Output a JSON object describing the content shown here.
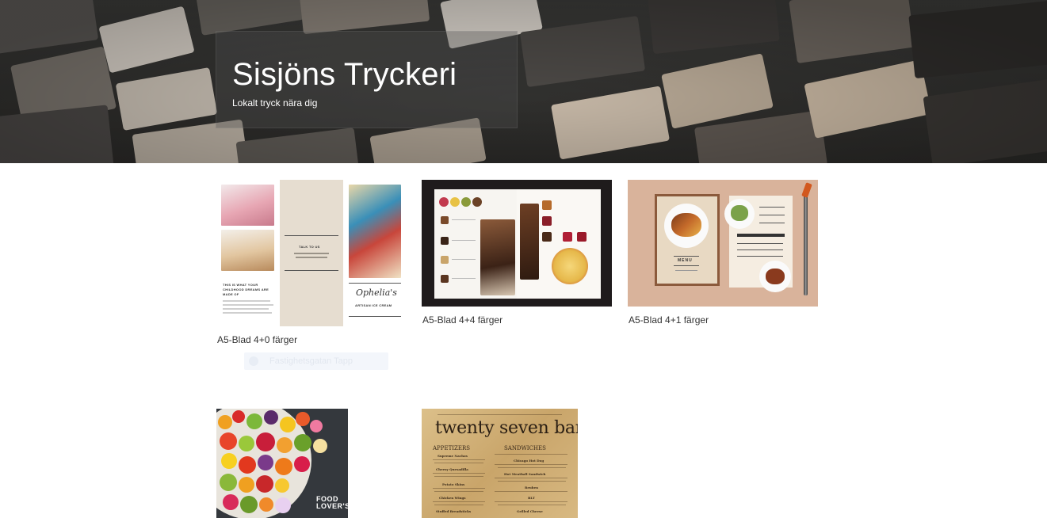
{
  "header": {
    "title": "Sisjöns Tryckeri",
    "tagline": "Lokalt tryck nära dig"
  },
  "products": [
    {
      "caption": "A5-Blad 4+0 färger",
      "image_text": {
        "talk": "TALK TO US",
        "headline": "THIS IS WHAT YOUR CHILDHOOD DREAMS ARE MADE OF",
        "brand": "Ophelia's",
        "brand_sub": "ARTISAN ICE CREAM"
      }
    },
    {
      "caption": "A5-Blad 4+4 färger"
    },
    {
      "caption": "A5-Blad 4+1 färger",
      "image_text": {
        "menu": "MENU"
      }
    },
    {
      "caption": "",
      "image_text": {
        "brand": "FOOD LOVER'S"
      }
    },
    {
      "caption": "",
      "image_text": {
        "title": "twenty seven bar",
        "section_left": "APPETIZERS",
        "section_right": "SANDWICHES",
        "left_items": [
          "Supreme Nachos",
          "Cheesy Quesadilla",
          "Potato Skins",
          "Chicken Wings",
          "Stuffed Breadsticks"
        ],
        "right_items": [
          "Chicago Hot Dog",
          "Hot Meatball Sandwich",
          "Reuben",
          "BLT",
          "Grilled Cheese"
        ]
      }
    }
  ],
  "faint_link": {
    "label": "Fastighetsgatan Tapp",
    "icon": "circle-icon"
  },
  "colors": {
    "background": "#ffffff",
    "title_text": "#ffffff",
    "caption_text": "#333333"
  }
}
